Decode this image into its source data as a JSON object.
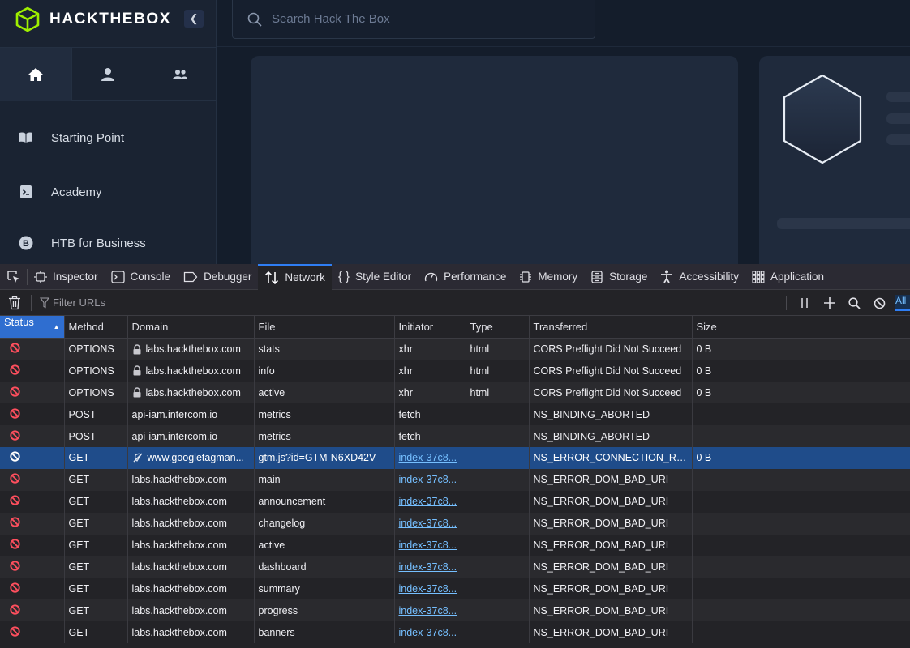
{
  "sidebar": {
    "logo_text": "HACKTHEBOX",
    "collapse_icon": "chevron-left-icon",
    "tabs": [
      {
        "icon": "home-icon"
      },
      {
        "icon": "user-icon"
      },
      {
        "icon": "team-icon"
      }
    ],
    "items": [
      {
        "label": "Starting Point",
        "icon": "book-icon"
      },
      {
        "label": "Academy",
        "icon": "terminal-icon"
      },
      {
        "label": "HTB for Business",
        "icon": "b-badge-icon"
      }
    ]
  },
  "search": {
    "placeholder": "Search Hack The Box"
  },
  "devtools": {
    "tabs": [
      {
        "label": "Inspector",
        "icon": "inspector-icon"
      },
      {
        "label": "Console",
        "icon": "console-icon"
      },
      {
        "label": "Debugger",
        "icon": "debugger-icon"
      },
      {
        "label": "Network",
        "icon": "network-icon",
        "active": true
      },
      {
        "label": "Style Editor",
        "icon": "style-editor-icon"
      },
      {
        "label": "Performance",
        "icon": "performance-icon"
      },
      {
        "label": "Memory",
        "icon": "memory-icon"
      },
      {
        "label": "Storage",
        "icon": "storage-icon"
      },
      {
        "label": "Accessibility",
        "icon": "accessibility-icon"
      },
      {
        "label": "Application",
        "icon": "application-icon"
      }
    ],
    "filter_placeholder": "Filter URLs",
    "all_label": "All",
    "columns": [
      "Status",
      "Method",
      "Domain",
      "File",
      "Initiator",
      "Type",
      "Transferred",
      "Size"
    ],
    "sorted_column": "Status",
    "rows": [
      {
        "status": "blocked",
        "method": "OPTIONS",
        "domain": "labs.hackthebox.com",
        "secure": true,
        "file": "stats",
        "initiator": "xhr",
        "type": "html",
        "transferred": "CORS Preflight Did Not Succeed",
        "size": "0 B"
      },
      {
        "status": "blocked",
        "method": "OPTIONS",
        "domain": "labs.hackthebox.com",
        "secure": true,
        "file": "info",
        "initiator": "xhr",
        "type": "html",
        "transferred": "CORS Preflight Did Not Succeed",
        "size": "0 B"
      },
      {
        "status": "blocked",
        "method": "OPTIONS",
        "domain": "labs.hackthebox.com",
        "secure": true,
        "file": "active",
        "initiator": "xhr",
        "type": "html",
        "transferred": "CORS Preflight Did Not Succeed",
        "size": "0 B"
      },
      {
        "status": "blocked",
        "method": "POST",
        "domain": "api-iam.intercom.io",
        "file": "metrics",
        "initiator": "fetch",
        "type": "",
        "transferred": "NS_BINDING_ABORTED",
        "size": ""
      },
      {
        "status": "blocked",
        "method": "POST",
        "domain": "api-iam.intercom.io",
        "file": "metrics",
        "initiator": "fetch",
        "type": "",
        "transferred": "NS_BINDING_ABORTED",
        "size": ""
      },
      {
        "status": "blocked",
        "method": "GET",
        "domain": "www.googletagman...",
        "tracker": true,
        "file": "gtm.js?id=GTM-N6XD42V",
        "initiator": "index-37c8...",
        "initiator_link": true,
        "type": "",
        "transferred": "NS_ERROR_CONNECTION_REF...",
        "size": "0 B",
        "selected": true
      },
      {
        "status": "blocked",
        "method": "GET",
        "domain": "labs.hackthebox.com",
        "file": "main",
        "initiator": "index-37c8...",
        "initiator_link": true,
        "type": "",
        "transferred": "NS_ERROR_DOM_BAD_URI",
        "size": ""
      },
      {
        "status": "blocked",
        "method": "GET",
        "domain": "labs.hackthebox.com",
        "file": "announcement",
        "initiator": "index-37c8...",
        "initiator_link": true,
        "type": "",
        "transferred": "NS_ERROR_DOM_BAD_URI",
        "size": ""
      },
      {
        "status": "blocked",
        "method": "GET",
        "domain": "labs.hackthebox.com",
        "file": "changelog",
        "initiator": "index-37c8...",
        "initiator_link": true,
        "type": "",
        "transferred": "NS_ERROR_DOM_BAD_URI",
        "size": ""
      },
      {
        "status": "blocked",
        "method": "GET",
        "domain": "labs.hackthebox.com",
        "file": "active",
        "initiator": "index-37c8...",
        "initiator_link": true,
        "type": "",
        "transferred": "NS_ERROR_DOM_BAD_URI",
        "size": ""
      },
      {
        "status": "blocked",
        "method": "GET",
        "domain": "labs.hackthebox.com",
        "file": "dashboard",
        "initiator": "index-37c8...",
        "initiator_link": true,
        "type": "",
        "transferred": "NS_ERROR_DOM_BAD_URI",
        "size": ""
      },
      {
        "status": "blocked",
        "method": "GET",
        "domain": "labs.hackthebox.com",
        "file": "summary",
        "initiator": "index-37c8...",
        "initiator_link": true,
        "type": "",
        "transferred": "NS_ERROR_DOM_BAD_URI",
        "size": ""
      },
      {
        "status": "blocked",
        "method": "GET",
        "domain": "labs.hackthebox.com",
        "file": "progress",
        "initiator": "index-37c8...",
        "initiator_link": true,
        "type": "",
        "transferred": "NS_ERROR_DOM_BAD_URI",
        "size": ""
      },
      {
        "status": "blocked",
        "method": "GET",
        "domain": "labs.hackthebox.com",
        "file": "banners",
        "initiator": "index-37c8...",
        "initiator_link": true,
        "type": "",
        "transferred": "NS_ERROR_DOM_BAD_URI",
        "size": ""
      }
    ]
  },
  "colors": {
    "brand_green": "#9fef00",
    "accent_blue": "#2f7ef4",
    "error_red": "#ff4f5e"
  }
}
